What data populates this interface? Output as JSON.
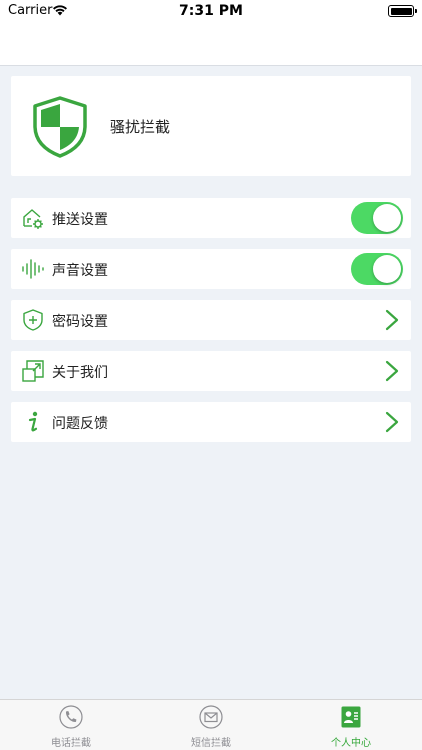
{
  "status_bar": {
    "carrier": "Carrier",
    "time": "7:31 PM"
  },
  "header": {
    "title": "骚扰拦截",
    "logo_icon": "shield-icon"
  },
  "settings": [
    {
      "label": "推送设置",
      "icon": "push-notification-icon",
      "control": "toggle",
      "enabled": true
    },
    {
      "label": "声音设置",
      "icon": "sound-wave-icon",
      "control": "toggle",
      "enabled": true
    },
    {
      "label": "密码设置",
      "icon": "shield-plus-icon",
      "control": "chevron"
    },
    {
      "label": "关于我们",
      "icon": "expand-window-icon",
      "control": "chevron"
    },
    {
      "label": "问题反馈",
      "icon": "info-icon",
      "control": "chevron"
    }
  ],
  "tabs": [
    {
      "label": "电话拦截",
      "icon": "phone-icon",
      "active": false
    },
    {
      "label": "短信拦截",
      "icon": "mail-icon",
      "active": false
    },
    {
      "label": "个人中心",
      "icon": "contact-card-icon",
      "active": true
    }
  ],
  "colors": {
    "accent": "#3aa63f",
    "toggle_on": "#4cd964",
    "background": "#eef2f7",
    "tab_inactive": "#8e8e93"
  }
}
